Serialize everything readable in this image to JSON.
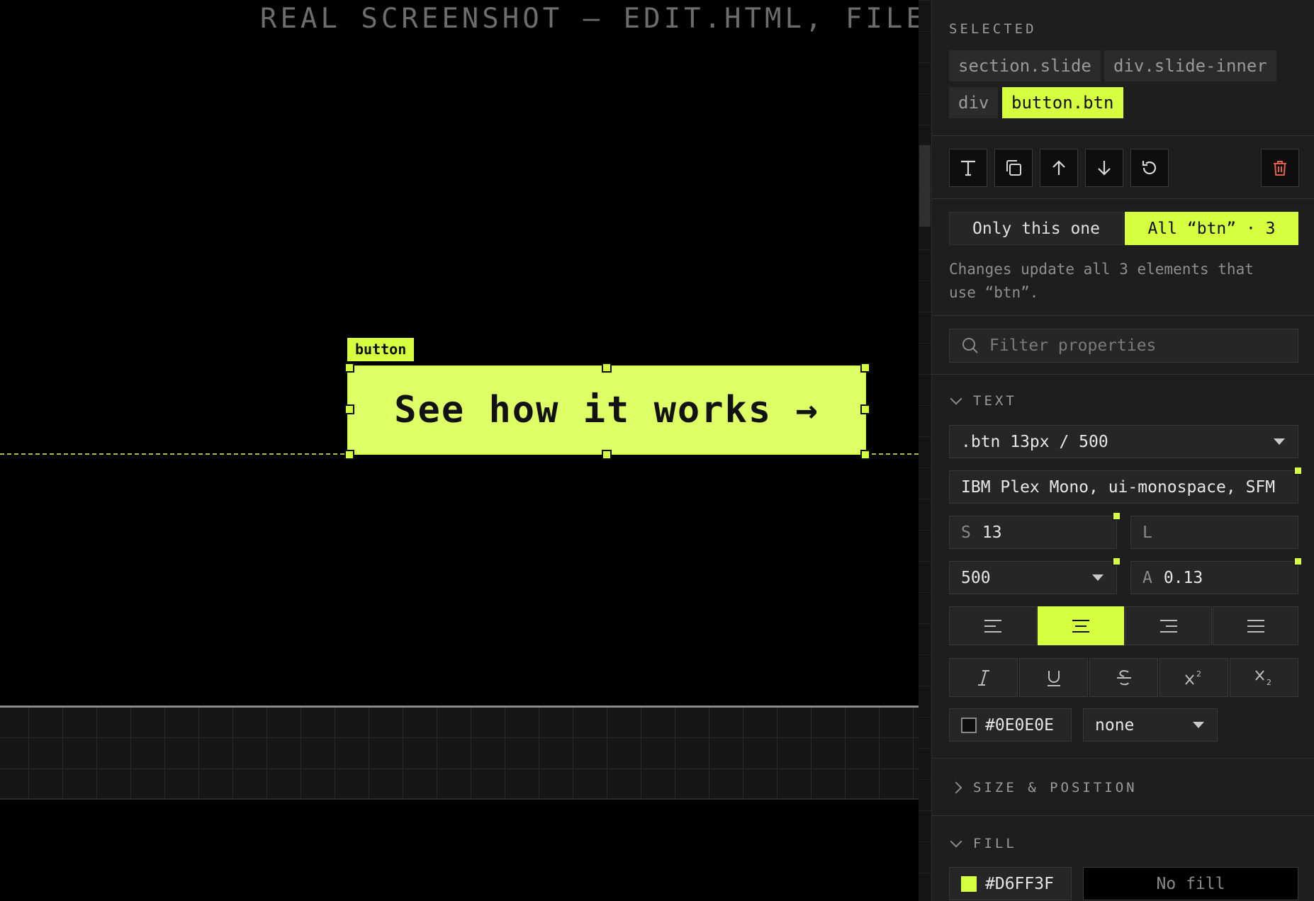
{
  "canvas": {
    "banner": "REAL SCREENSHOT — EDIT.HTML, FILE OPE",
    "selection_tag": "button",
    "button_text": "See how it works →"
  },
  "panel": {
    "selected_label": "SELECTED",
    "breadcrumb": [
      "section.slide",
      "div.slide-inner",
      "div",
      "button.btn"
    ],
    "scope": {
      "only_this": "Only this one",
      "all_btn": "All “btn” · 3",
      "note": "Changes update all 3 elements that use “btn”."
    },
    "filter_placeholder": "Filter properties",
    "text_section": {
      "title": "TEXT",
      "style_select": ".btn 13px / 500",
      "font_family": "IBM Plex Mono, ui-monospace, SFM",
      "size_prefix": "S",
      "size_value": "13",
      "line_prefix": "L",
      "line_value": "",
      "weight_value": "500",
      "tracking_prefix": "A",
      "tracking_value": "0.13",
      "color_value": "#0E0E0E",
      "decoration_value": "none"
    },
    "size_position_title": "SIZE & POSITION",
    "fill_section": {
      "title": "FILL",
      "color_value": "#D6FF3F",
      "no_fill_label": "No fill"
    }
  },
  "colors": {
    "accent": "#D6FF3F",
    "text_color": "#0E0E0E",
    "panel_bg": "#1E1E1E",
    "delete": "#E0604A"
  },
  "icons": {
    "toolbar": [
      "text-icon",
      "duplicate-icon",
      "arrow-up-icon",
      "arrow-down-icon",
      "reset-icon",
      "trash-icon"
    ],
    "align": [
      "align-left-icon",
      "align-center-icon",
      "align-right-icon",
      "align-justify-icon"
    ],
    "format": [
      "italic-icon",
      "underline-icon",
      "strikethrough-icon",
      "superscript-icon",
      "subscript-icon"
    ]
  }
}
